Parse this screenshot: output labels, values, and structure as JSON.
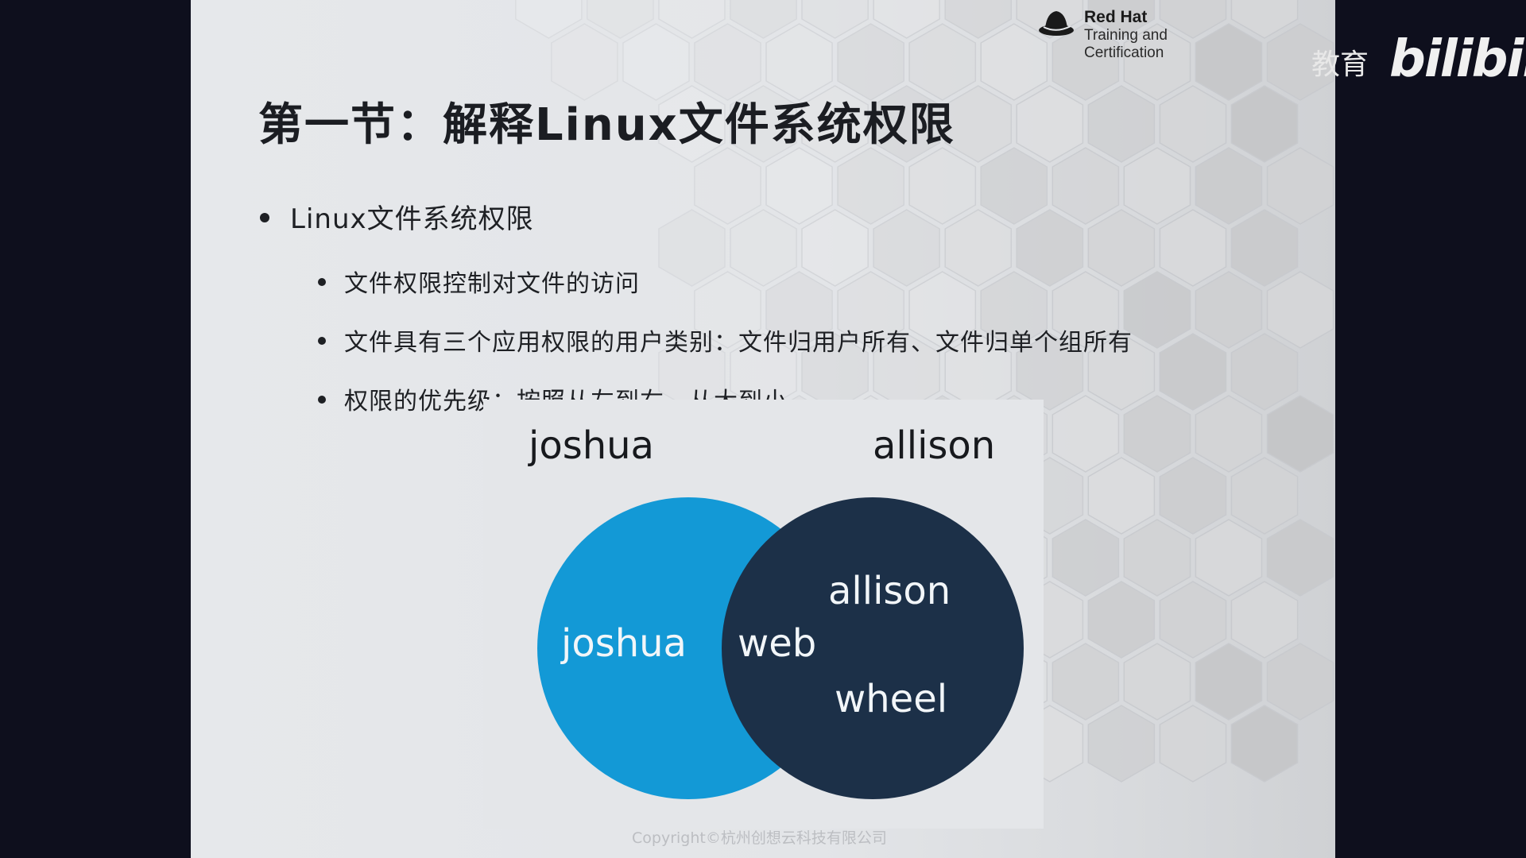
{
  "brand": {
    "name": "Red Hat",
    "subtitle": "Training and\nCertification"
  },
  "slide": {
    "title": "第一节：解释Linux文件系统权限",
    "bullet_main": "Linux文件系统权限",
    "sub_bullets": [
      "文件权限控制对文件的访问",
      "文件具有三个应用权限的用户类别：文件归用户所有、文件归单个组所有",
      "权限的优先级：按照从左到右，从大到小"
    ]
  },
  "venn": {
    "left_user": "joshua",
    "right_user": "allison",
    "left_circle_label": "joshua",
    "overlap_label": "web",
    "right_group_1": "allison",
    "right_group_2": "wheel",
    "left_color": "#1399d6",
    "right_color": "#1c3048"
  },
  "footer": {
    "copyright": "Copyright©杭州创想云科技有限公司"
  },
  "watermark": {
    "text": "教育",
    "logo": "bilibili"
  }
}
